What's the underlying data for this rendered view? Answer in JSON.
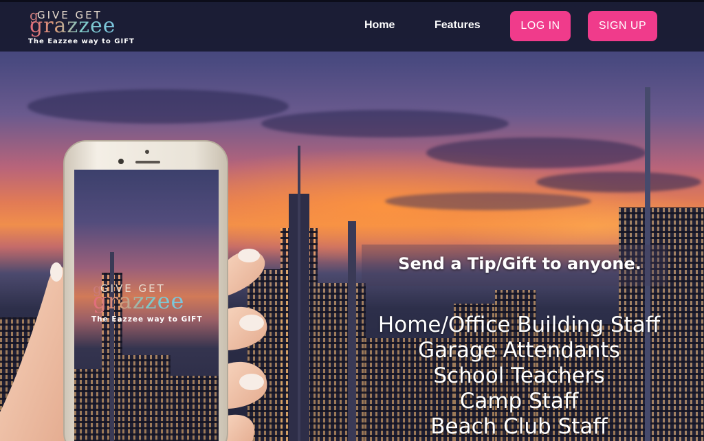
{
  "brand": {
    "logo_top": "GIVE GET",
    "logo_word": "grazzee",
    "tagline": "The Eazzee way to GIFT"
  },
  "nav": {
    "links": [
      {
        "label": "Home"
      },
      {
        "label": "Features"
      }
    ],
    "login_label": "LOG IN",
    "signup_label": "SIGN UP",
    "button_color": "#f03b8b"
  },
  "phone_screen": {
    "logo_top": "GIVE GET",
    "logo_word": "grazzee",
    "tagline": "The Eazzee way to GIFT"
  },
  "hero": {
    "headline": "Send a Tip/Gift to anyone.",
    "recipients": [
      "Home/Office Building Staff",
      "Garage Attendants",
      "School Teachers",
      "Camp Staff",
      "Beach Club Staff"
    ]
  }
}
